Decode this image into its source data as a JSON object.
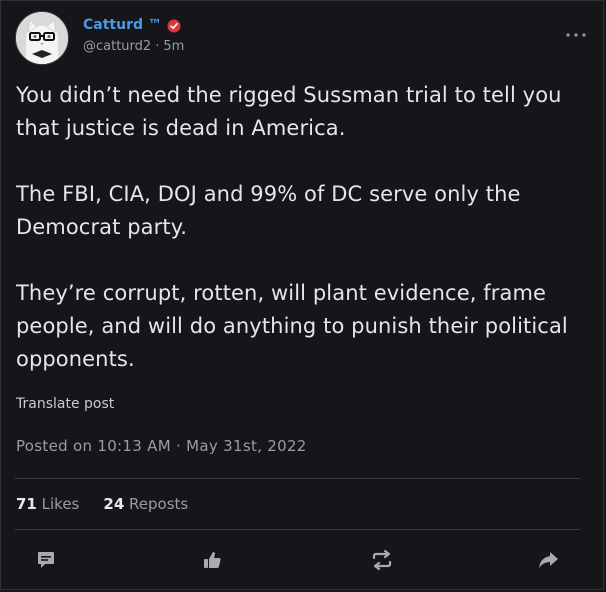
{
  "author": {
    "display_name": "Catturd ™",
    "handle": "@catturd2",
    "separator": "·",
    "time_ago": "5m"
  },
  "post": {
    "text": "You didn’t need the rigged Sussman trial to tell you that justice is dead in America.\n\nThe FBI, CIA, DOJ and 99% of DC serve only the Democrat party.\n\nThey’re corrupt, rotten, will plant evidence, frame people, and will do anything to punish their political opponents.",
    "translate_label": "Translate post",
    "posted_label": "Posted on 10:13 AM · May 31st, 2022"
  },
  "stats": {
    "likes_count": "71",
    "likes_label": "Likes",
    "reposts_count": "24",
    "reposts_label": "Reposts"
  },
  "icons": {
    "more": "more-icon",
    "reply": "comment-icon",
    "like": "thumbs-up-icon",
    "repost": "repost-icon",
    "share": "share-icon",
    "verified": "verified-icon"
  },
  "colors": {
    "background": "#15161a",
    "name": "#4a99e9",
    "verified": "#d63a3a",
    "muted": "#9a9ca3"
  }
}
